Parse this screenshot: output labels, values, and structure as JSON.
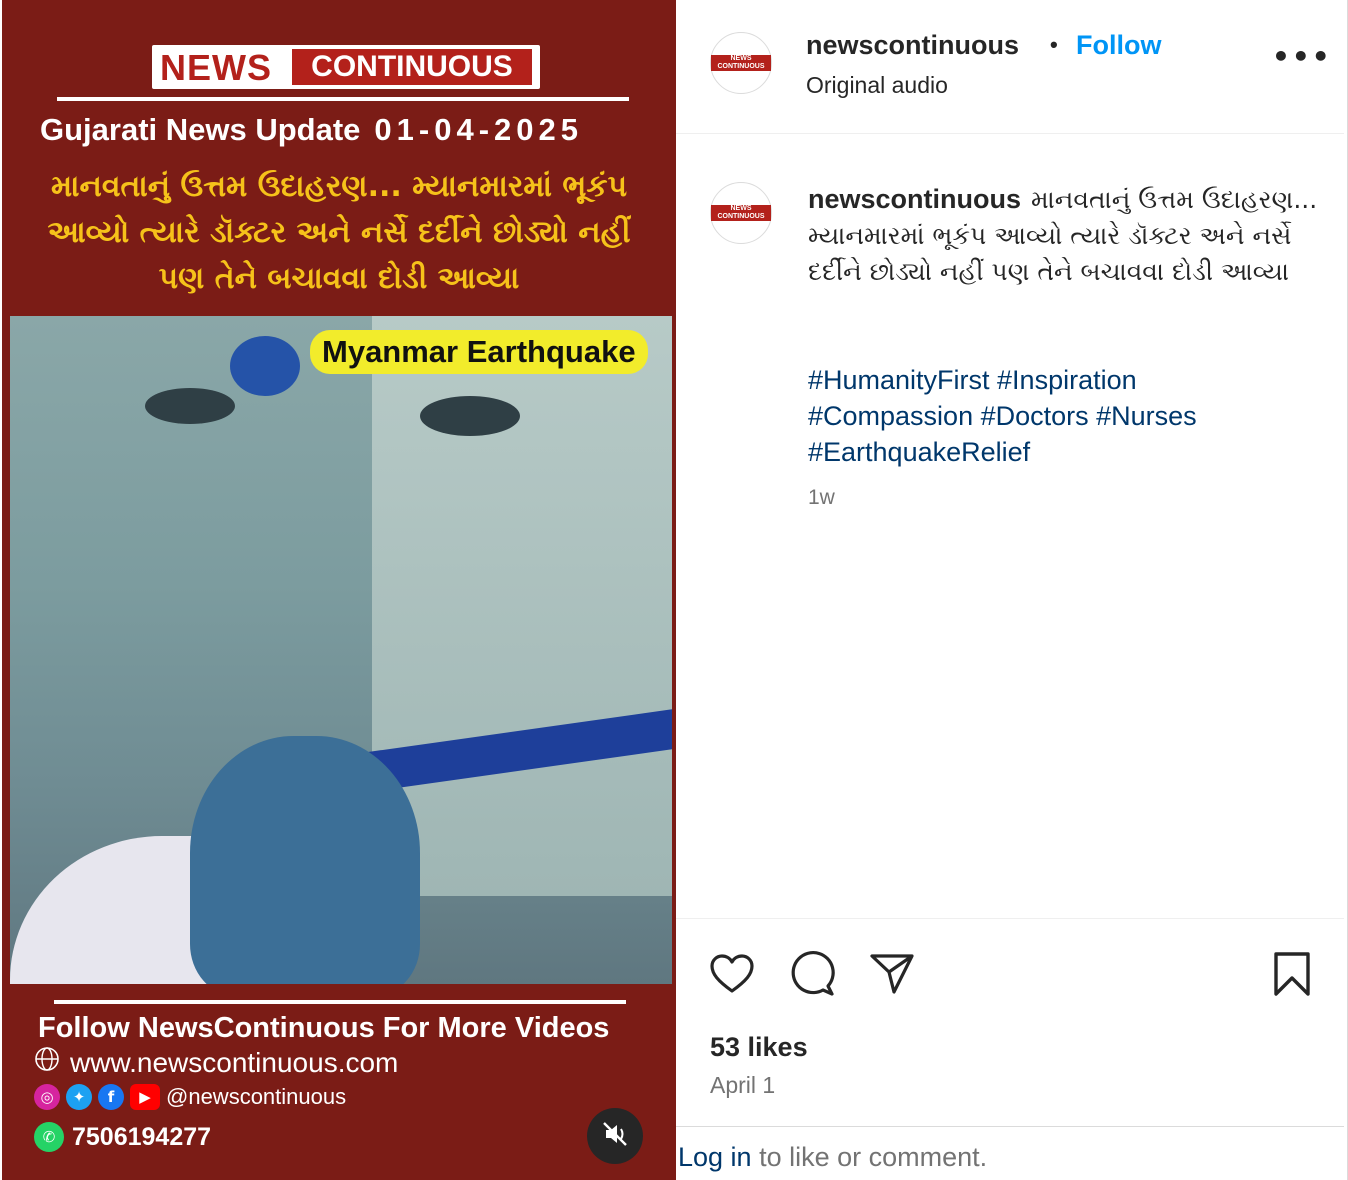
{
  "media": {
    "logo_news": "NEWS",
    "logo_continuous": "CONTINUOUS",
    "update_label": "Gujarati News Update",
    "update_date": "01-04-2025",
    "gujarati_headline": "માનવતાનું ઉત્તમ ઉદાહરણ... મ્યાનમારમાં ભૂકંપ આવ્યો ત્યારે ડૉક્ટર અને નર્સે દર્દીને છોડ્યો નહીં પણ તેને બચાવવા દોડી આવ્યા",
    "video_tag": "Myanmar Earthquake",
    "follow_text": "Follow NewsContinuous For More Videos",
    "website": "www.newscontinuous.com",
    "social_handle": "@newscontinuous",
    "phone": "7506194277",
    "colors": {
      "background": "#7b1c16",
      "headline": "#f6c21a",
      "tag_bg": "#f2ec2b"
    }
  },
  "header": {
    "username": "newscontinuous",
    "separator": "•",
    "follow_label": "Follow",
    "audio_label": "Original audio",
    "more_icon": "more-horizontal-icon",
    "avatar_text": "NEWS CONTINUOUS"
  },
  "caption": {
    "username": "newscontinuous",
    "text": "માનવતાનું ઉત્તમ ઉદાહરણ... મ્યાનમારમાં ભૂકંપ આવ્યો ત્યારે ડૉક્ટર અને નર્સે દર્દીને છોડ્યો નહીં પણ તેને બચાવવા દોડી આવ્યા",
    "hashtags": "#HumanityFirst #Inspiration #Compassion #Doctors #Nurses #EarthquakeRelief",
    "time_ago": "1w"
  },
  "actions": {
    "like_icon": "heart-icon",
    "comment_icon": "comment-icon",
    "share_icon": "send-icon",
    "save_icon": "bookmark-icon",
    "likes": "53 likes",
    "date": "April 1"
  },
  "footer": {
    "login_link": "Log in",
    "login_rest": " to like or comment."
  },
  "colors": {
    "link_blue": "#0095f6",
    "hashtag": "#00376b",
    "muted": "#737373"
  }
}
